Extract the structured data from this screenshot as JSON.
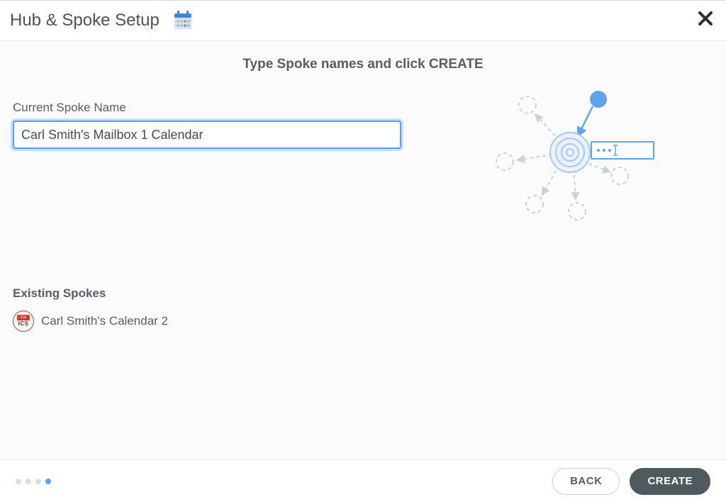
{
  "header": {
    "title": "Hub & Spoke Setup"
  },
  "subheading": "Type Spoke names and click CREATE",
  "current_spoke": {
    "label": "Current Spoke Name",
    "value": "Carl Smith's Mailbox 1 Calendar"
  },
  "existing_spokes": {
    "title": "Existing Spokes",
    "items": [
      {
        "icon": "ics",
        "name": "Carl Smith's Calendar 2"
      }
    ]
  },
  "footer": {
    "back_label": "BACK",
    "create_label": "CREATE",
    "active_step_index": 3,
    "total_steps": 4
  },
  "ics_icon_text": "ICS"
}
